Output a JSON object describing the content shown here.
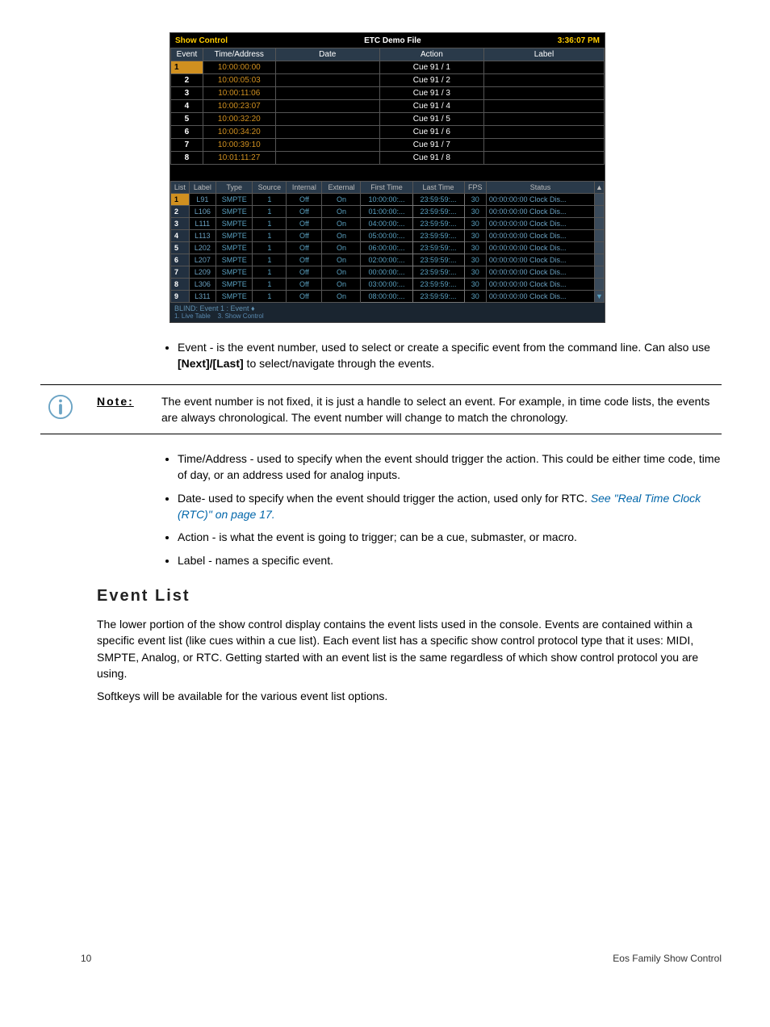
{
  "titlebar": {
    "left": "Show Control",
    "center": "ETC Demo File",
    "right": "3:36:07 PM"
  },
  "topHeaders": [
    "Event",
    "Time/Address",
    "Date",
    "Action",
    "Label"
  ],
  "topRows": [
    {
      "num": "1",
      "time": "10:00:00:00",
      "date": "",
      "action": "Cue 91 / 1",
      "label": "",
      "selected": true
    },
    {
      "num": "2",
      "time": "10:00:05:03",
      "date": "",
      "action": "Cue 91 / 2",
      "label": "",
      "selected": false
    },
    {
      "num": "3",
      "time": "10:00:11:06",
      "date": "",
      "action": "Cue 91 / 3",
      "label": "",
      "selected": false
    },
    {
      "num": "4",
      "time": "10:00:23:07",
      "date": "",
      "action": "Cue 91 / 4",
      "label": "",
      "selected": false
    },
    {
      "num": "5",
      "time": "10:00:32:20",
      "date": "",
      "action": "Cue 91 / 5",
      "label": "",
      "selected": false
    },
    {
      "num": "6",
      "time": "10:00:34:20",
      "date": "",
      "action": "Cue 91 / 6",
      "label": "",
      "selected": false
    },
    {
      "num": "7",
      "time": "10:00:39:10",
      "date": "",
      "action": "Cue 91 / 7",
      "label": "",
      "selected": false
    },
    {
      "num": "8",
      "time": "10:01:11:27",
      "date": "",
      "action": "Cue 91 / 8",
      "label": "",
      "selected": false
    }
  ],
  "lowHeaders": [
    "List",
    "Label",
    "Type",
    "Source",
    "Internal",
    "External",
    "First Time",
    "Last Time",
    "FPS",
    "Status"
  ],
  "lowRows": [
    {
      "num": "1",
      "label": "L91",
      "type": "SMPTE",
      "source": "1",
      "internal": "Off",
      "external": "On",
      "first": "10:00:00:...",
      "last": "23:59:59:...",
      "fps": "30",
      "status": "00:00:00:00 Clock Dis...",
      "selected": true
    },
    {
      "num": "2",
      "label": "L106",
      "type": "SMPTE",
      "source": "1",
      "internal": "Off",
      "external": "On",
      "first": "01:00:00:...",
      "last": "23:59:59:...",
      "fps": "30",
      "status": "00:00:00:00 Clock Dis...",
      "selected": false
    },
    {
      "num": "3",
      "label": "L111",
      "type": "SMPTE",
      "source": "1",
      "internal": "Off",
      "external": "On",
      "first": "04:00:00:...",
      "last": "23:59:59:...",
      "fps": "30",
      "status": "00:00:00:00 Clock Dis...",
      "selected": false
    },
    {
      "num": "4",
      "label": "L113",
      "type": "SMPTE",
      "source": "1",
      "internal": "Off",
      "external": "On",
      "first": "05:00:00:...",
      "last": "23:59:59:...",
      "fps": "30",
      "status": "00:00:00:00 Clock Dis...",
      "selected": false
    },
    {
      "num": "5",
      "label": "L202",
      "type": "SMPTE",
      "source": "1",
      "internal": "Off",
      "external": "On",
      "first": "06:00:00:...",
      "last": "23:59:59:...",
      "fps": "30",
      "status": "00:00:00:00 Clock Dis...",
      "selected": false
    },
    {
      "num": "6",
      "label": "L207",
      "type": "SMPTE",
      "source": "1",
      "internal": "Off",
      "external": "On",
      "first": "02:00:00:...",
      "last": "23:59:59:...",
      "fps": "30",
      "status": "00:00:00:00 Clock Dis...",
      "selected": false
    },
    {
      "num": "7",
      "label": "L209",
      "type": "SMPTE",
      "source": "1",
      "internal": "Off",
      "external": "On",
      "first": "00:00:00:...",
      "last": "23:59:59:...",
      "fps": "30",
      "status": "00:00:00:00 Clock Dis...",
      "selected": false
    },
    {
      "num": "8",
      "label": "L306",
      "type": "SMPTE",
      "source": "1",
      "internal": "Off",
      "external": "On",
      "first": "03:00:00:...",
      "last": "23:59:59:...",
      "fps": "30",
      "status": "00:00:00:00 Clock Dis...",
      "selected": false
    },
    {
      "num": "9",
      "label": "L311",
      "type": "SMPTE",
      "source": "1",
      "internal": "Off",
      "external": "On",
      "first": "08:00:00:...",
      "last": "23:59:59:...",
      "fps": "30",
      "status": "00:00:00:00 Clock Dis...",
      "selected": false
    }
  ],
  "statusbar": {
    "line1": "BLIND: Event 1 :  Event ♦",
    "line2a": "1. Live Table",
    "line2b": "3. Show Control"
  },
  "bullets": {
    "event_a": "Event - is the event number, used to select or create a specific event from the command line. Can also use ",
    "event_bold": "[Next]/[Last]",
    "event_b": " to select/navigate through the events.",
    "time": "Time/Address - used to specify when the event should trigger the action. This could be either time code, time of day, or an address used for analog inputs.",
    "date_a": "Date- used to specify when the event should trigger the action, used only for RTC. ",
    "date_link": "See \"Real Time Clock (RTC)\" on page 17.",
    "action": "Action - is what the event is going to trigger; can be a cue, submaster, or macro.",
    "label": "Label - names a specific event."
  },
  "note": {
    "label": "Note:",
    "text": "The event number is not fixed, it is just a handle to select an event. For example, in time code lists, the events are always chronological. The event number will change to match the chronology."
  },
  "heading": "Event List",
  "para1": "The lower portion of the show control display contains the event lists used in the console. Events are contained within a specific event list (like cues within a cue list). Each event list has a specific show control protocol type that it uses: MIDI, SMPTE, Analog, or RTC. Getting started with an event list is the same regardless of which show control protocol you are using.",
  "para2": "Softkeys will be available for the various event list options.",
  "footer": {
    "page": "10",
    "title": "Eos Family Show Control"
  }
}
